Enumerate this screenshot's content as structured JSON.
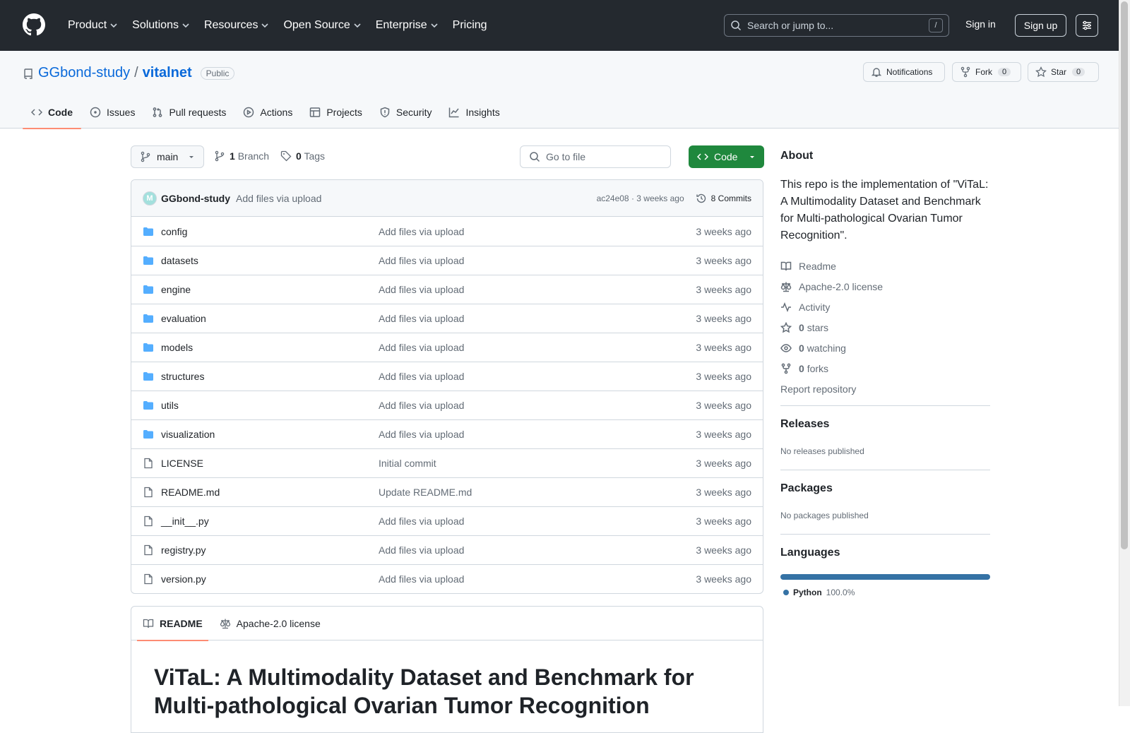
{
  "header": {
    "nav": [
      "Product",
      "Solutions",
      "Resources",
      "Open Source",
      "Enterprise",
      "Pricing"
    ],
    "search_placeholder": "Search or jump to...",
    "search_key": "/",
    "signin": "Sign in",
    "signup": "Sign up"
  },
  "repo": {
    "owner": "GGbond-study",
    "separator": "/",
    "name": "vitalnet",
    "visibility": "Public",
    "notifications": "Notifications",
    "fork": "Fork",
    "fork_count": "0",
    "star": "Star",
    "star_count": "0",
    "tabs": [
      "Code",
      "Issues",
      "Pull requests",
      "Actions",
      "Projects",
      "Security",
      "Insights"
    ]
  },
  "toolbar": {
    "branch": "main",
    "branch_count": "1",
    "branch_label": "Branch",
    "tag_count": "0",
    "tag_label": "Tags",
    "goto_placeholder": "Go to file",
    "code_button": "Code"
  },
  "commit": {
    "author": "GGbond-study",
    "message": "Add files via upload",
    "meta": "ac24e08 · 3 weeks ago",
    "commits": "8 Commits"
  },
  "files": [
    {
      "name": "config",
      "type": "dir",
      "message": "Add files via upload",
      "time": "3 weeks ago"
    },
    {
      "name": "datasets",
      "type": "dir",
      "message": "Add files via upload",
      "time": "3 weeks ago"
    },
    {
      "name": "engine",
      "type": "dir",
      "message": "Add files via upload",
      "time": "3 weeks ago"
    },
    {
      "name": "evaluation",
      "type": "dir",
      "message": "Add files via upload",
      "time": "3 weeks ago"
    },
    {
      "name": "models",
      "type": "dir",
      "message": "Add files via upload",
      "time": "3 weeks ago"
    },
    {
      "name": "structures",
      "type": "dir",
      "message": "Add files via upload",
      "time": "3 weeks ago"
    },
    {
      "name": "utils",
      "type": "dir",
      "message": "Add files via upload",
      "time": "3 weeks ago"
    },
    {
      "name": "visualization",
      "type": "dir",
      "message": "Add files via upload",
      "time": "3 weeks ago"
    },
    {
      "name": "LICENSE",
      "type": "file",
      "message": "Initial commit",
      "time": "3 weeks ago"
    },
    {
      "name": "README.md",
      "type": "file",
      "message": "Update README.md",
      "time": "3 weeks ago"
    },
    {
      "name": "__init__.py",
      "type": "file",
      "message": "Add files via upload",
      "time": "3 weeks ago"
    },
    {
      "name": "registry.py",
      "type": "file",
      "message": "Add files via upload",
      "time": "3 weeks ago"
    },
    {
      "name": "version.py",
      "type": "file",
      "message": "Add files via upload",
      "time": "3 weeks ago"
    }
  ],
  "readme": {
    "tab_readme": "README",
    "tab_license": "Apache-2.0 license",
    "title": "ViTaL: A Multimodality Dataset and Benchmark for Multi-pathological Ovarian Tumor Recognition"
  },
  "about": {
    "heading": "About",
    "description": "This repo is the implementation of \"ViTaL: A Multimodality Dataset and Benchmark for Multi-pathological Ovarian Tumor Recognition\".",
    "readme": "Readme",
    "license": "Apache-2.0 license",
    "activity": "Activity",
    "stars_count": "0",
    "stars_label": "stars",
    "watching_count": "0",
    "watching_label": "watching",
    "forks_count": "0",
    "forks_label": "forks",
    "report": "Report repository"
  },
  "releases": {
    "heading": "Releases",
    "text": "No releases published"
  },
  "packages": {
    "heading": "Packages",
    "text": "No packages published"
  },
  "languages": {
    "heading": "Languages",
    "name": "Python",
    "percent": "100.0%",
    "color": "#3572a5"
  }
}
